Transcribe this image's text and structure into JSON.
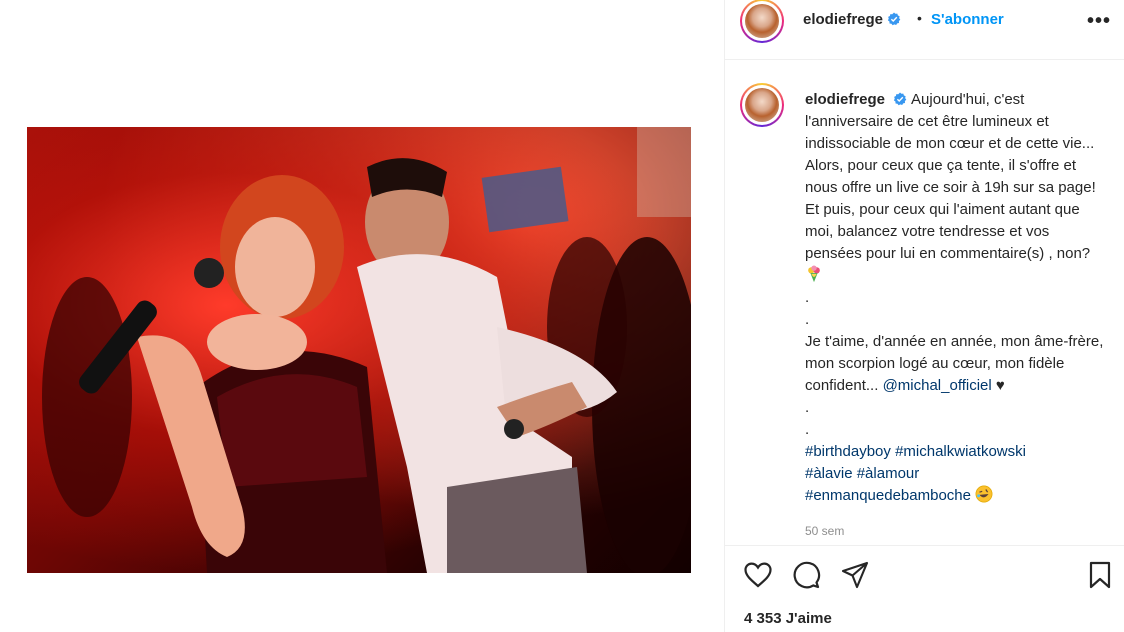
{
  "post": {
    "username": "elodiefrege",
    "separator": "•",
    "follow_label": "S'abonner",
    "more_label": "•••",
    "caption": {
      "p1": "Aujourd'hui, c'est l'anniversaire de cet être lumineux et indissociable de mon cœur et de cette vie... Alors, pour ceux que ça tente, il s'offre et nous offre un live ce soir à 19h sur sa page! Et puis, pour ceux qui l'aiment autant que moi, balancez votre tendresse et vos pensées pour lui en commentaire(s) , non?",
      "dot1": ".",
      "dot2": ".",
      "p2": "Je t'aime, d'année en année, mon âme-frère, mon scorpion logé au cœur, mon fidèle confident...",
      "mention": "@michal_officiel",
      "heart": "♥",
      "dot3": ".",
      "dot4": ".",
      "hashtags": [
        "#birthdayboy",
        "#michalkwiatkowski",
        "#àlavie",
        "#àlamour",
        "#enmanquedebamboche"
      ]
    },
    "time_ago": "50 sem",
    "likes_text": "4 353 J'aime"
  },
  "icons": {
    "verified": "verified-badge-icon",
    "like": "heart-outline-icon",
    "comment": "comment-bubble-icon",
    "share": "paper-plane-icon",
    "save": "bookmark-icon",
    "bouquet": "bouquet-emoji",
    "laugh": "rolling-laughing-emoji"
  },
  "colors": {
    "accent": "#0095f6",
    "link": "#00376b",
    "muted": "#8e8e8e",
    "text": "#262626"
  }
}
